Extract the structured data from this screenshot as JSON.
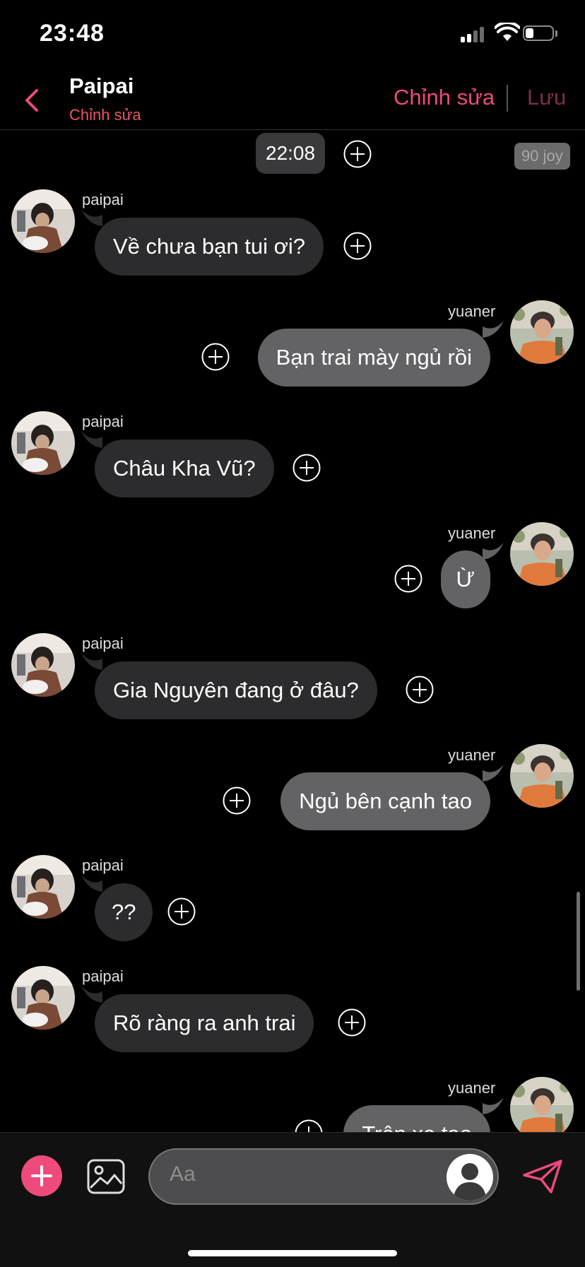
{
  "status_bar": {
    "time": "23:48"
  },
  "header": {
    "title": "Paipai",
    "subtitle": "Chỉnh sửa",
    "edit_label": "Chỉnh sửa",
    "save_label": "Lưu"
  },
  "chat": {
    "timestamp": "22:08",
    "badge": "90 joy",
    "messages": [
      {
        "sender": "paipai",
        "side": "left",
        "text": "Về chưa bạn tui ơi?"
      },
      {
        "sender": "yuaner",
        "side": "right",
        "text": "Bạn trai mày ngủ rồi"
      },
      {
        "sender": "paipai",
        "side": "left",
        "text": "Châu Kha Vũ?"
      },
      {
        "sender": "yuaner",
        "side": "right",
        "text": "Ừ"
      },
      {
        "sender": "paipai",
        "side": "left",
        "text": "Gia Nguyên đang ở đâu?"
      },
      {
        "sender": "yuaner",
        "side": "right",
        "text": "Ngủ bên cạnh tao"
      },
      {
        "sender": "paipai",
        "side": "left",
        "text": "??"
      },
      {
        "sender": "paipai",
        "side": "left",
        "text": "Rõ ràng ra anh trai"
      },
      {
        "sender": "yuaner",
        "side": "right",
        "text": "Trên xe tao"
      }
    ]
  },
  "composer": {
    "placeholder": "Aa"
  },
  "colors": {
    "accent": "#ee4a7c",
    "bubble_left": "#2c2c2e",
    "bubble_right": "#636366",
    "save_inactive": "#7d2f48"
  }
}
